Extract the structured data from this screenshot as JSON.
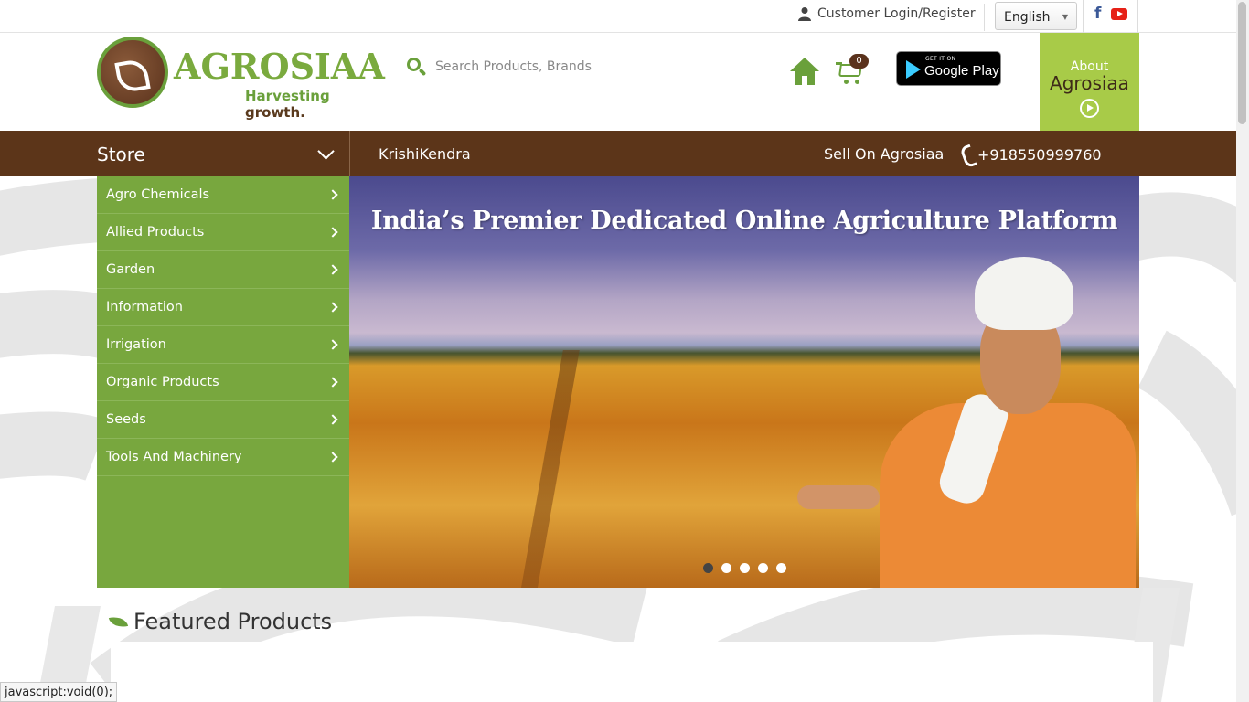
{
  "topbar": {
    "login_label": "Customer Login/Register",
    "language": "English",
    "social": [
      "facebook-icon",
      "youtube-icon"
    ]
  },
  "header": {
    "brand": "AGROSIAA",
    "tagline_a": "Harvesting",
    "tagline_b": "growth.",
    "search_placeholder": "Search Products, Brands",
    "cart_count": "0",
    "gplay_small": "GET IT ON",
    "gplay_big": "Google Play",
    "about_line1": "About",
    "about_line2": "Agrosiaa"
  },
  "nav": {
    "store_label": "Store",
    "krishi_label": "KrishiKendra",
    "sell_label": "Sell On Agrosiaa",
    "phone": "+918550999760"
  },
  "sidebar": {
    "items": [
      {
        "label": "Agro Chemicals"
      },
      {
        "label": "Allied Products"
      },
      {
        "label": "Garden"
      },
      {
        "label": "Information"
      },
      {
        "label": "Irrigation"
      },
      {
        "label": "Organic Products"
      },
      {
        "label": "Seeds"
      },
      {
        "label": "Tools And Machinery"
      }
    ]
  },
  "banner": {
    "headline": "India’s Premier Dedicated Online Agriculture Platform",
    "slide_count": 5,
    "active_slide": 1
  },
  "featured": {
    "title": "Featured Products"
  },
  "status": {
    "text": "javascript:void(0);"
  },
  "colors": {
    "green": "#78a73e",
    "brown": "#5c3519",
    "lime": "#a8cb48"
  }
}
